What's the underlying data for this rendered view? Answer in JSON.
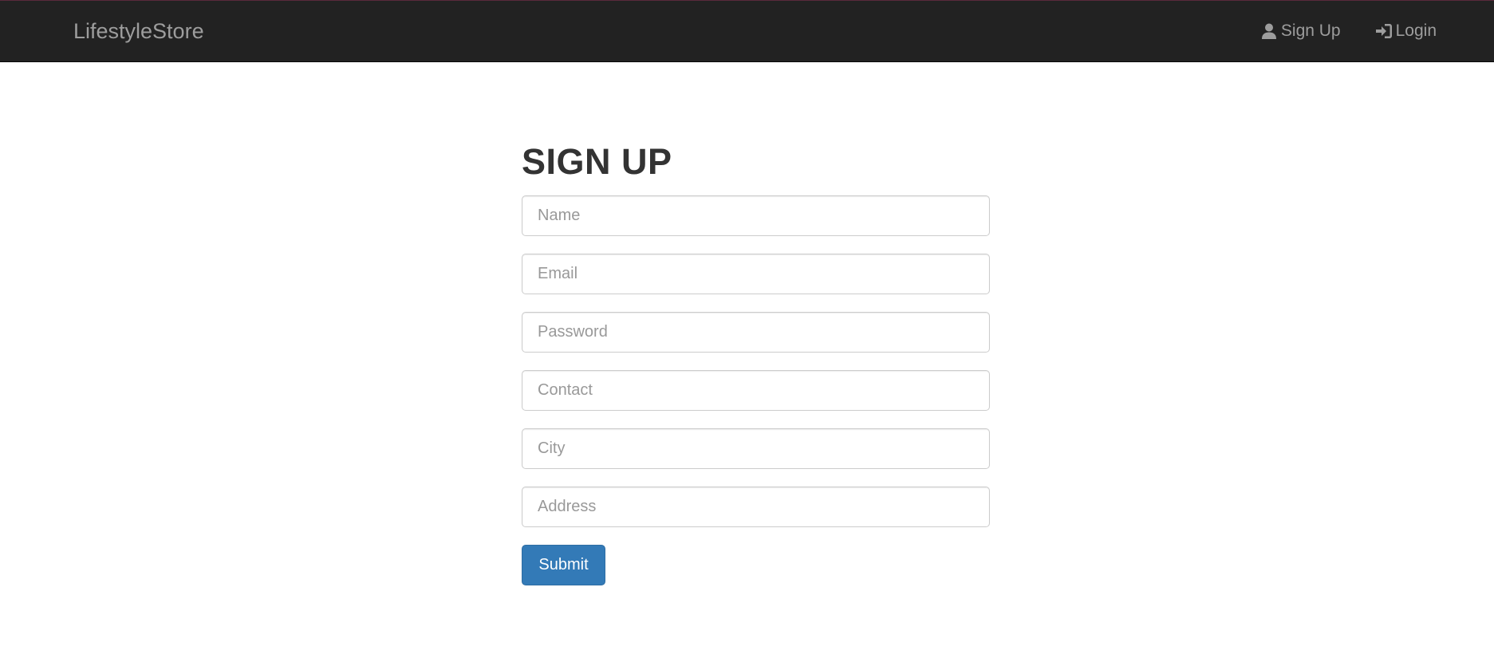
{
  "navbar": {
    "brand": "LifestyleStore",
    "links": [
      {
        "label": "Sign Up",
        "icon": "user-icon"
      },
      {
        "label": "Login",
        "icon": "login-icon"
      }
    ]
  },
  "form": {
    "title": "SIGN UP",
    "fields": [
      {
        "placeholder": "Name",
        "value": ""
      },
      {
        "placeholder": "Email",
        "value": ""
      },
      {
        "placeholder": "Password",
        "value": ""
      },
      {
        "placeholder": "Contact",
        "value": ""
      },
      {
        "placeholder": "City",
        "value": ""
      },
      {
        "placeholder": "Address",
        "value": ""
      }
    ],
    "submit_label": "Submit"
  },
  "colors": {
    "navbar_bg": "#222222",
    "nav_text": "#9d9d9d",
    "primary_button": "#337ab7",
    "title_text": "#333333"
  }
}
